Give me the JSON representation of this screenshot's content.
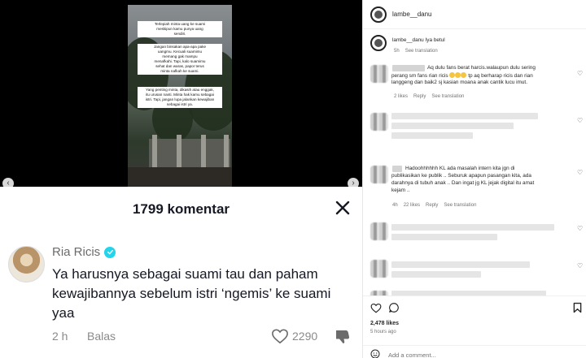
{
  "tiktok": {
    "video_caption": [
      "Terlepiah minta uang ke suami\nmeskipun kamu punya uang\nsendiri.",
      "Jangan binsakan apa-apa pake\nuangmu. Kecuali suamimu\nmemang gak mampu\nmenafkahi. Tapi, kalo suamimu\nsehat dan waras, papor terus\nminta nafkah ke suami.",
      "Yang penting minta, dikasih atau enggak,\nitu urusan nanti. Minta hak kamu sebagai\nistri. Tapi, jangan lupa jalankan kewajiban\nsebagai istri ya."
    ],
    "comment_count": "1799 komentar",
    "comment": {
      "author": "Ria Ricis",
      "text": "Ya harusnya sebagai suami tau dan paham kewajibannya sebelum istri ‘ngemis’ ke suami yaa",
      "time": "2 h",
      "reply_label": "Balas",
      "likes": "2290"
    },
    "icons": [
      "close-icon",
      "verified-icon",
      "heart-outline-icon",
      "dislike-icon",
      "chevron-left-icon",
      "chevron-right-icon"
    ]
  },
  "instagram": {
    "username": "lambe__danu",
    "reply": {
      "username": "lambe__danu",
      "text": "Iya betul",
      "time": "5h",
      "translation_label": "See translation"
    },
    "comments": [
      {
        "lines": [
          "Aq dulu fans berat harcis.walaupun dulu sering",
          "perang sm fans rian ricis",
          "tp aq berharap ricis dan rian",
          "langgeng dan baik2 sj kasian moana anak cantik lucu imut."
        ],
        "likes": "2 likes",
        "reply_label": "Reply",
        "translation_label": "See translation"
      },
      {
        "lines": [
          "Hadoohhhhhh KL ada masalah intern kita jgn di",
          "publikasikan ke publik .. Seburuk apapun pasangan kita, ada",
          "darahnya di tubuh anak .. Dan ingat jg KL jejak digital itu amat",
          "kejam .."
        ],
        "time": "4h",
        "likes": "22 likes",
        "reply_label": "Reply",
        "translation_label": "See translation"
      }
    ],
    "likes_count": "2,478 likes",
    "post_time": "5 hours ago",
    "add_comment_placeholder": "Add a comment..."
  }
}
